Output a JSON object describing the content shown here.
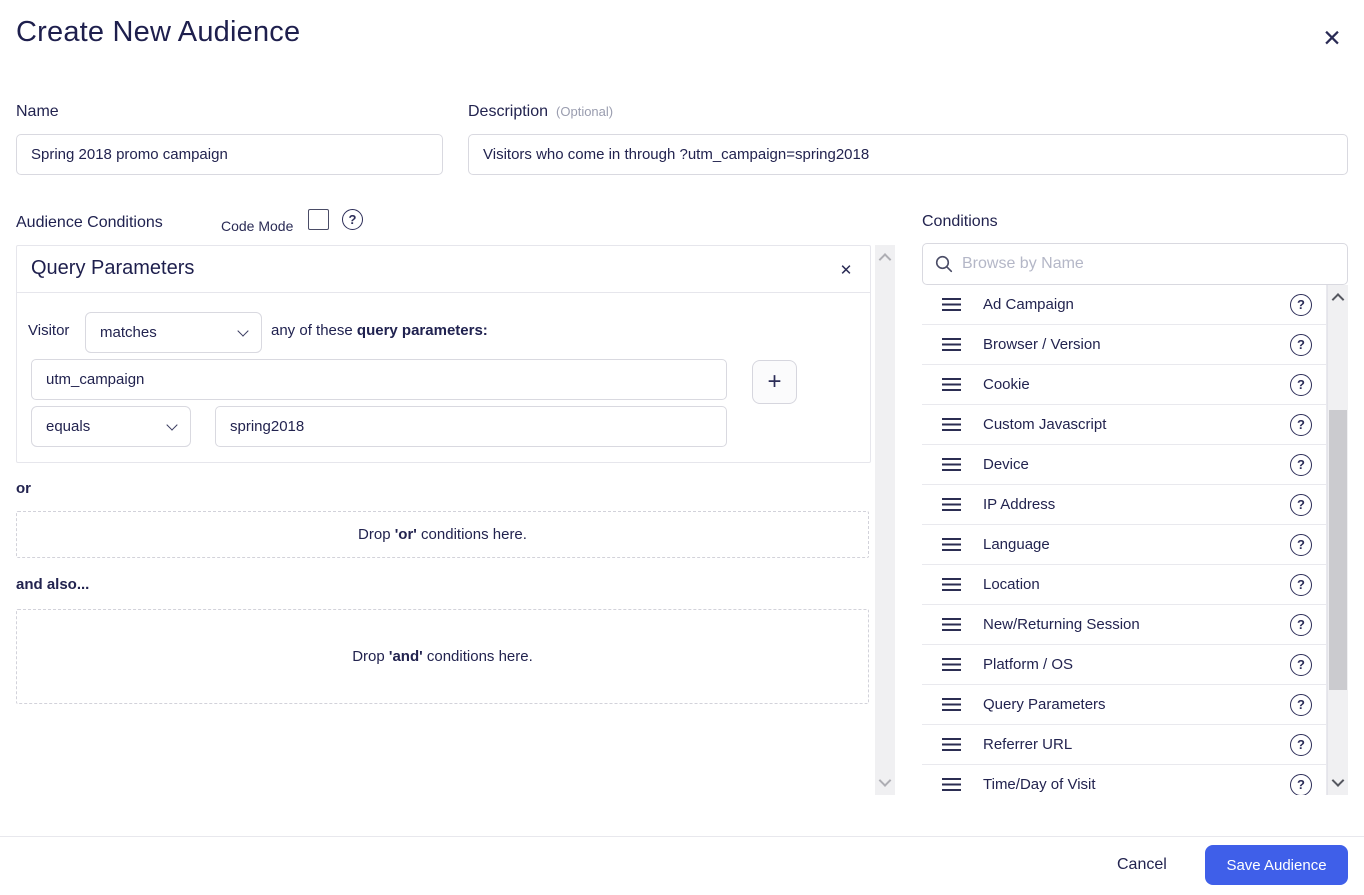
{
  "header": {
    "title": "Create New Audience"
  },
  "icons": {
    "close": "✕",
    "card_close": "✕",
    "plus": "+",
    "question": "?"
  },
  "name_field": {
    "label": "Name",
    "value": "Spring 2018 promo campaign"
  },
  "description_field": {
    "label": "Description",
    "optional": "(Optional)",
    "value": "Visitors who come in through ?utm_campaign=spring2018"
  },
  "builder": {
    "section_label": "Audience Conditions",
    "code_mode_label": "Code Mode",
    "code_mode_checked": false,
    "card": {
      "title": "Query Parameters",
      "subject": "Visitor",
      "match_value": "matches",
      "clause_prefix": "any of these ",
      "clause_bold": "query parameters:",
      "param_name": "utm_campaign",
      "operator_value": "equals",
      "param_value": "spring2018"
    },
    "or_label": "or",
    "or_drop": {
      "prefix": "Drop ",
      "bold": "'or'",
      "suffix": " conditions here."
    },
    "and_label": "and also...",
    "and_drop": {
      "prefix": "Drop ",
      "bold": "'and'",
      "suffix": " conditions here."
    }
  },
  "conditions_panel": {
    "title": "Conditions",
    "search_placeholder": "Browse by Name",
    "items": [
      "Ad Campaign",
      "Browser / Version",
      "Cookie",
      "Custom Javascript",
      "Device",
      "IP Address",
      "Language",
      "Location",
      "New/Returning Session",
      "Platform / OS",
      "Query Parameters",
      "Referrer URL",
      "Time/Day of Visit"
    ]
  },
  "footer": {
    "cancel_label": "Cancel",
    "save_label": "Save Audience"
  },
  "colors": {
    "navy": "#22234f",
    "accent_blue": "#3f5fe9"
  }
}
